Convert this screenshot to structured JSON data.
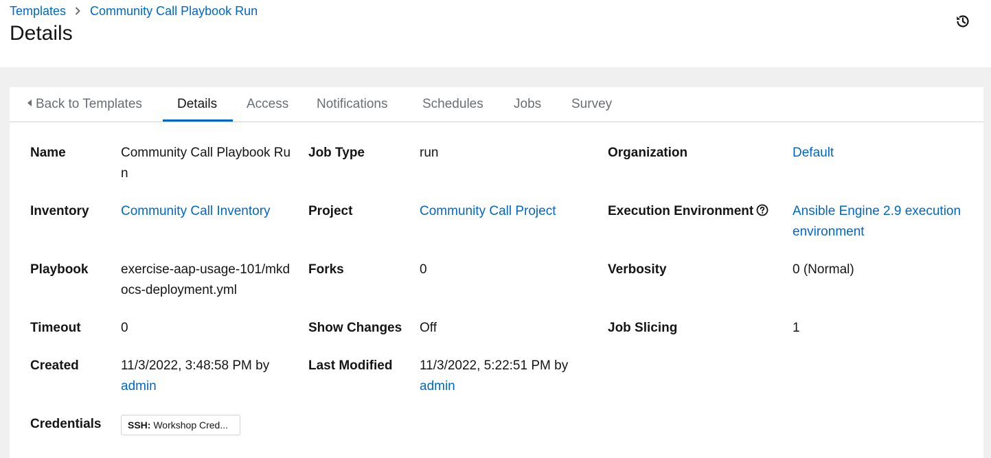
{
  "breadcrumb": {
    "root": "Templates",
    "current": "Community Call Playbook Run"
  },
  "page_title": "Details",
  "history_button": {
    "icon": "history-icon"
  },
  "tabs": [
    {
      "label": "Back to Templates"
    },
    {
      "label": "Details",
      "active": true
    },
    {
      "label": "Access"
    },
    {
      "label": "Notifications"
    },
    {
      "label": "Schedules"
    },
    {
      "label": "Jobs"
    },
    {
      "label": "Survey"
    }
  ],
  "details": {
    "name": {
      "label": "Name",
      "value": "Community Call Playbook Run"
    },
    "job_type": {
      "label": "Job Type",
      "value": "run"
    },
    "organization": {
      "label": "Organization",
      "value": "Default"
    },
    "inventory": {
      "label": "Inventory",
      "value": "Community Call Inventory"
    },
    "project": {
      "label": "Project",
      "value": "Community Call Project"
    },
    "execution_environment": {
      "label": "Execution Environment",
      "value": "Ansible Engine 2.9 execution environment"
    },
    "playbook": {
      "label": "Playbook",
      "value": "exercise-aap-usage-101/mkdocs-deployment.yml"
    },
    "forks": {
      "label": "Forks",
      "value": "0"
    },
    "verbosity": {
      "label": "Verbosity",
      "value": "0 (Normal)"
    },
    "timeout": {
      "label": "Timeout",
      "value": "0"
    },
    "show_changes": {
      "label": "Show Changes",
      "value": "Off"
    },
    "job_slicing": {
      "label": "Job Slicing",
      "value": "1"
    },
    "created": {
      "label": "Created",
      "date": "11/3/2022, 3:48:58 PM by",
      "user": "admin"
    },
    "last_modified": {
      "label": "Last Modified",
      "date": "11/3/2022, 5:22:51 PM by",
      "user": "admin"
    },
    "credentials": {
      "label": "Credentials",
      "type": "SSH:",
      "name": "Workshop Cred..."
    }
  },
  "colors": {
    "link": "#0066cc",
    "tab_active_underline": "#0066cc",
    "muted": "#6a6e73"
  }
}
